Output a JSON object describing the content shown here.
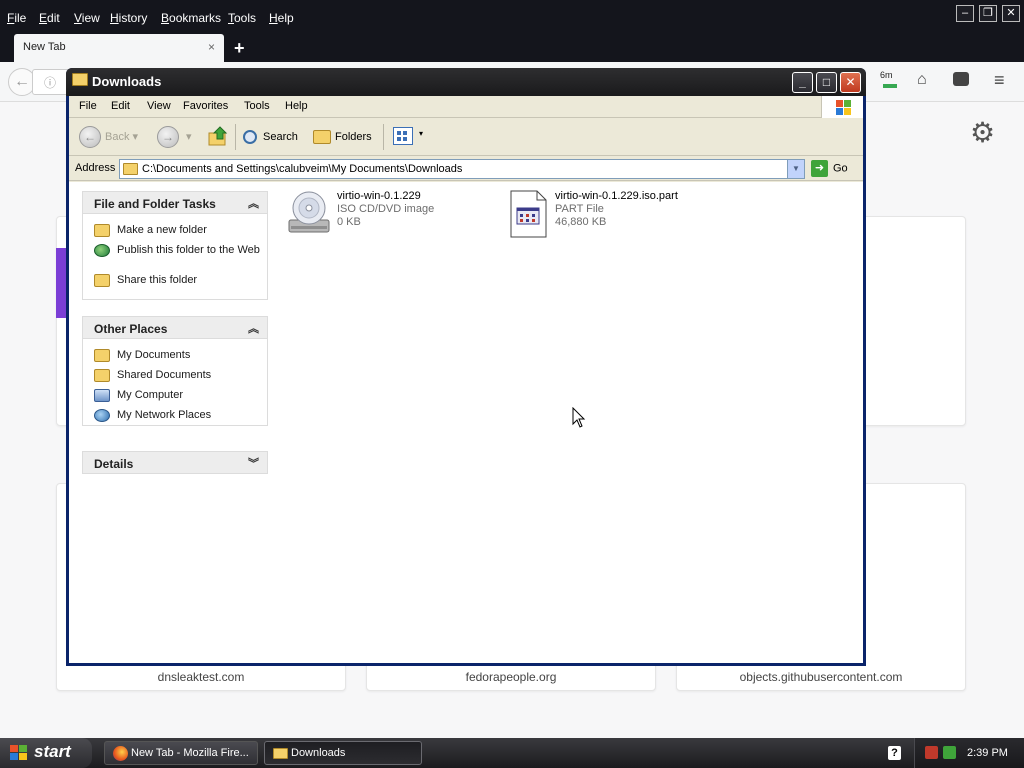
{
  "firefox": {
    "menus": [
      "File",
      "Edit",
      "View",
      "History",
      "Bookmarks",
      "Tools",
      "Help"
    ],
    "tab_title": "New Tab",
    "tab_close": "×",
    "new_tab": "+",
    "ext_badge": "6m",
    "tiles": [
      "dnsleaktest.com",
      "fedorapeople.org",
      "objects.githubusercontent.com"
    ]
  },
  "explorer": {
    "title": "Downloads",
    "menus": [
      "File",
      "Edit",
      "View",
      "Favorites",
      "Tools",
      "Help"
    ],
    "toolbar": {
      "back": "Back",
      "search": "Search",
      "folders": "Folders"
    },
    "address": {
      "label": "Address",
      "path": "C:\\Documents and Settings\\calubveim\\My Documents\\Downloads",
      "go": "Go"
    },
    "panels": {
      "file_tasks": {
        "title": "File and Folder Tasks",
        "items": [
          "Make a new folder",
          "Publish this folder to the Web",
          "Share this folder"
        ]
      },
      "other_places": {
        "title": "Other Places",
        "items": [
          "My Documents",
          "Shared Documents",
          "My Computer",
          "My Network Places"
        ]
      },
      "details": {
        "title": "Details"
      }
    },
    "files": [
      {
        "name": "virtio-win-0.1.229",
        "type": "ISO CD/DVD image",
        "size": "0 KB",
        "icon": "cd-drive-icon"
      },
      {
        "name": "virtio-win-0.1.229.iso.part",
        "type": "PART File",
        "size": "46,880 KB",
        "icon": "generic-file-icon"
      }
    ]
  },
  "taskbar": {
    "start": "start",
    "buttons": [
      "New Tab - Mozilla Fire...",
      "Downloads"
    ],
    "clock": "2:39 PM",
    "help": "?"
  },
  "colors": {
    "firefox_chrome": "#14151c",
    "xp_face": "#ece9d8",
    "xp_title": "#1a1a1c",
    "close_red": "#c03a20"
  }
}
